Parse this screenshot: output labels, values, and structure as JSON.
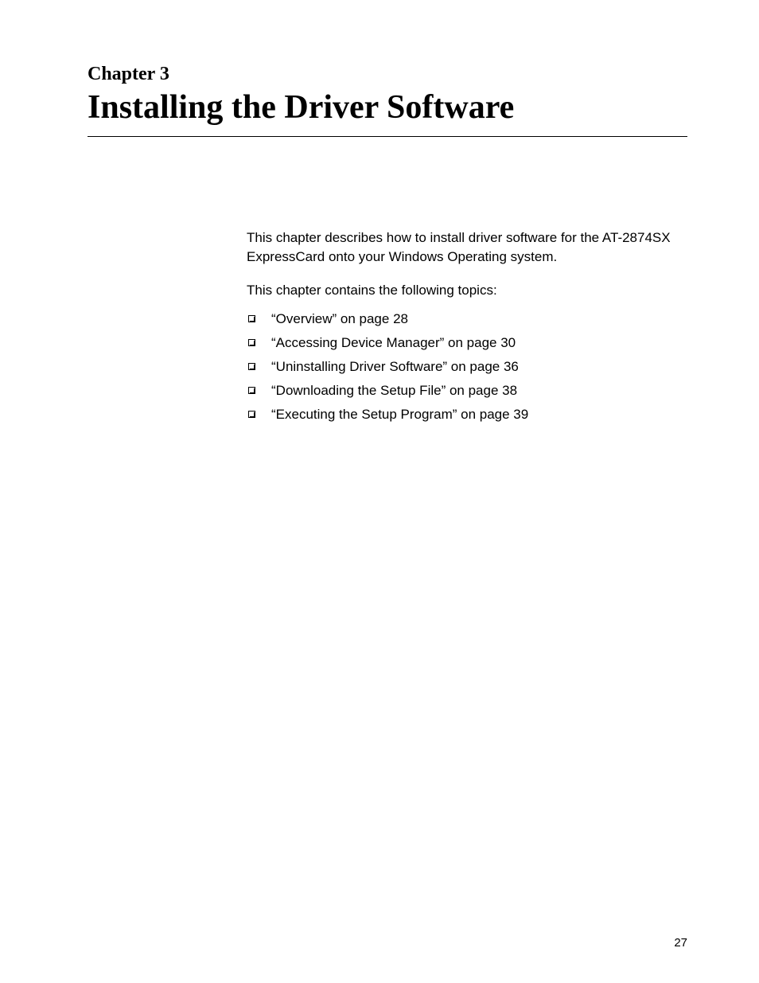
{
  "header": {
    "chapter_label": "Chapter 3",
    "chapter_title": "Installing the Driver Software"
  },
  "content": {
    "intro": "This chapter describes how to install driver software for the AT-2874SX ExpressCard onto your Windows Operating system.",
    "topics_label": "This chapter contains the following topics:",
    "topics": [
      "“Overview” on page 28",
      "“Accessing Device Manager” on page 30",
      "“Uninstalling Driver Software” on page 36",
      "“Downloading the Setup File” on page 38",
      "“Executing the Setup Program” on page 39"
    ]
  },
  "page_number": "27"
}
